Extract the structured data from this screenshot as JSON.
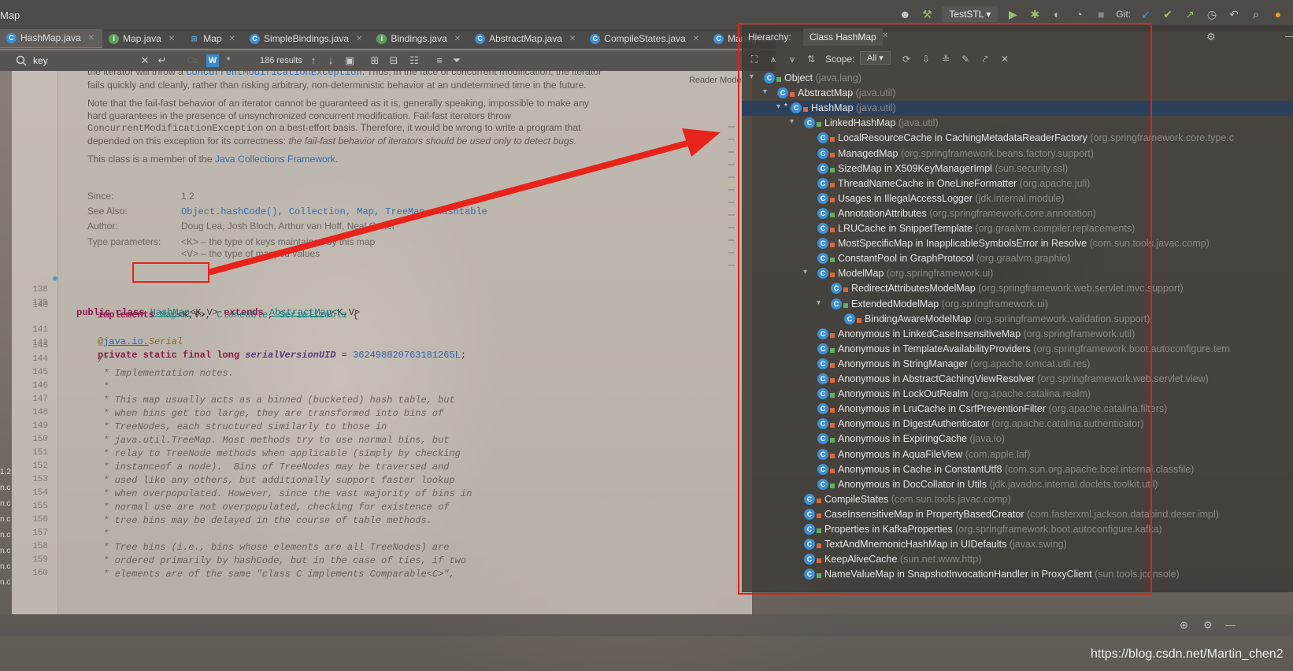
{
  "topbar": {
    "title": "Map",
    "run_config": "TestSTL",
    "git_label": "Git:"
  },
  "tabs": [
    {
      "label": "HashMap.java",
      "active": true,
      "icon": "class-icon"
    },
    {
      "label": "Map.java",
      "active": false,
      "icon": "interface-icon"
    },
    {
      "label": "Map",
      "active": false,
      "icon": "structure-icon"
    },
    {
      "label": "SimpleBindings.java",
      "active": false,
      "icon": "class-icon"
    },
    {
      "label": "Bindings.java",
      "active": false,
      "icon": "interface-icon"
    },
    {
      "label": "AbstractMap.java",
      "active": false,
      "icon": "class-icon"
    },
    {
      "label": "CompileStates.java",
      "active": false,
      "icon": "class-icon"
    },
    {
      "label": "ManagedMap.cl",
      "active": false,
      "icon": "class-icon"
    }
  ],
  "findbar": {
    "query": "key",
    "results": "186 results",
    "cc_label": "Cc",
    "w_label": "W"
  },
  "editor": {
    "reader_mode": "Reader Mode",
    "doc": {
      "p1a": "the iterator will throw a ",
      "p1b": "ConcurrentModificationException",
      "p1c": ". Thus, in the face of concurrent modification, the iterator fails quickly and cleanly, rather than risking arbitrary, non-deterministic behavior at an undetermined time in the future.",
      "p2a": "Note that the fail-fast behavior of an iterator cannot be guaranteed as it is, generally speaking, impossible to make any hard guarantees in the presence of unsynchronized concurrent modification. Fail-fast iterators throw ",
      "p2b": "ConcurrentModificationException",
      "p2c": " on a best-effort basis. Therefore, it would be wrong to write a program that depended on this exception for its correctness: ",
      "p2d": "the fail-fast behavior of iterators should be used only to detect bugs.",
      "p3a": "This class is a member of the ",
      "p3b": "Java Collections Framework",
      "p3c": ".",
      "since_label": "Since:",
      "since_value": "1.2",
      "seealso_label": "See Also:",
      "seealso_value": "Object.hashCode(), Collection, Map, TreeMap, Hashtable",
      "author_label": "Author:",
      "author_value": "Doug Lea, Josh Bloch, Arthur van Hoff, Neal Gafter",
      "typeparams_label": "Type parameters:",
      "typeparam_k": "<K> – the type of keys maintained by this map",
      "typeparam_v": "<V> – the type of mapped values"
    },
    "code": {
      "l138": "138",
      "l139": "139",
      "l140": "140",
      "l141": "141",
      "l142": "142",
      "l143": "143",
      "l144": "144",
      "l145": "145",
      "l146": "146",
      "l147": "147",
      "l148": "148",
      "l149": "149",
      "l150": "150",
      "l151": "151",
      "l152": "152",
      "l153": "153",
      "l154": "154",
      "l155": "155",
      "l156": "156",
      "l157": "157",
      "l158": "158",
      "l159": "159",
      "l160": "160",
      "kw_public_class": "public class ",
      "hashmap": "HashMap",
      "kv": "<K,V>",
      "kw_extends": " extends ",
      "abstractmap": "AbstractMap",
      "kv2": "<K,V>",
      "kw_implements": "implements ",
      "implements_rest_map": "Map",
      "implements_rest_kv": "<K,V>, ",
      "cloneable": "Cloneable",
      "comma": ", ",
      "serializable": "Serializable",
      "brace": " {",
      "ann_at": "@",
      "ann_pkg": "java.io.",
      "ann_name": "Serial",
      "kw_private": "private static final long ",
      "serial_field": "serialVersionUID",
      "serial_eq": " = ",
      "serial_val": "362498820763181265L",
      "semi": ";",
      "c144": "/*",
      "c145": " * Implementation notes.",
      "c146": " *",
      "c147": " * This map usually acts as a binned (bucketed) hash table, but",
      "c148": " * when bins get too large, they are transformed into bins of",
      "c149": " * TreeNodes, each structured similarly to those in",
      "c150": " * java.util.TreeMap. Most methods try to use normal bins, but",
      "c151": " * relay to TreeNode methods when applicable (simply by checking",
      "c152": " * instanceof a node).  Bins of TreeNodes may be traversed and",
      "c153": " * used like any others, but additionally support faster lookup",
      "c154": " * when overpopulated. However, since the vast majority of bins in",
      "c155": " * normal use are not overpopulated, checking for existence of",
      "c156": " * tree bins may be delayed in the course of table methods.",
      "c157": " *",
      "c158": " * Tree bins (i.e., bins whose elements are all TreeNodes) are",
      "c159": " * ordered primarily by hashCode, but in the case of ties, if two",
      "c160": " * elements are of the same \"class C implements Comparable<C>\","
    }
  },
  "hierarchy": {
    "label": "Hierarchy:",
    "tab": "Class HashMap",
    "scope_label": "Scope:",
    "scope_value": "All",
    "rows": [
      {
        "name": "Object",
        "pkg": "(java.lang)"
      },
      {
        "name": "AbstractMap",
        "pkg": "(java.util)"
      },
      {
        "name": "HashMap",
        "pkg": "(java.util)"
      },
      {
        "name": "LinkedHashMap",
        "pkg": "(java.util)"
      },
      {
        "name": "LocalResourceCache in CachingMetadataReaderFactory",
        "pkg": "(org.springframework.core.type.c"
      },
      {
        "name": "ManagedMap",
        "pkg": "(org.springframework.beans.factory.support)"
      },
      {
        "name": "SizedMap in X509KeyManagerImpl",
        "pkg": "(sun.security.ssl)"
      },
      {
        "name": "ThreadNameCache in OneLineFormatter",
        "pkg": "(org.apache.juli)"
      },
      {
        "name": "Usages in IllegalAccessLogger",
        "pkg": "(jdk.internal.module)"
      },
      {
        "name": "AnnotationAttributes",
        "pkg": "(org.springframework.core.annotation)"
      },
      {
        "name": "LRUCache in SnippetTemplate",
        "pkg": "(org.graalvm.compiler.replacements)"
      },
      {
        "name": "MostSpecificMap in InapplicableSymbolsError in Resolve",
        "pkg": "(com.sun.tools.javac.comp)"
      },
      {
        "name": "ConstantPool in GraphProtocol",
        "pkg": "(org.graalvm.graphio)"
      },
      {
        "name": "ModelMap",
        "pkg": "(org.springframework.ui)"
      },
      {
        "name": "RedirectAttributesModelMap",
        "pkg": "(org.springframework.web.servlet.mvc.support)"
      },
      {
        "name": "ExtendedModelMap",
        "pkg": "(org.springframework.ui)"
      },
      {
        "name": "BindingAwareModelMap",
        "pkg": "(org.springframework.validation.support)"
      },
      {
        "name": "Anonymous in LinkedCaseInsensitiveMap",
        "pkg": "(org.springframework.util)"
      },
      {
        "name": "Anonymous in TemplateAvailabilityProviders",
        "pkg": "(org.springframework.boot.autoconfigure.tem"
      },
      {
        "name": "Anonymous in StringManager",
        "pkg": "(org.apache.tomcat.util.res)"
      },
      {
        "name": "Anonymous in AbstractCachingViewResolver",
        "pkg": "(org.springframework.web.servlet.view)"
      },
      {
        "name": "Anonymous in LockOutRealm",
        "pkg": "(org.apache.catalina.realm)"
      },
      {
        "name": "Anonymous in LruCache in CsrfPreventionFilter",
        "pkg": "(org.apache.catalina.filters)"
      },
      {
        "name": "Anonymous in DigestAuthenticator",
        "pkg": "(org.apache.catalina.authenticator)"
      },
      {
        "name": "Anonymous in ExpiringCache",
        "pkg": "(java.io)"
      },
      {
        "name": "Anonymous in AquaFileView",
        "pkg": "(com.apple.laf)"
      },
      {
        "name": "Anonymous in Cache in ConstantUtf8",
        "pkg": "(com.sun.org.apache.bcel.internal.classfile)"
      },
      {
        "name": "Anonymous in DocCollator in Utils",
        "pkg": "(jdk.javadoc.internal.doclets.toolkit.util)"
      },
      {
        "name": "CompileStates",
        "pkg": "(com.sun.tools.javac.comp)"
      },
      {
        "name": "CaseInsensitiveMap in PropertyBasedCreator",
        "pkg": "(com.fasterxml.jackson.databind.deser.impl)"
      },
      {
        "name": "Properties in KafkaProperties",
        "pkg": "(org.springframework.boot.autoconfigure.kafka)"
      },
      {
        "name": "TextAndMnemonicHashMap in UIDefaults",
        "pkg": "(javax.swing)"
      },
      {
        "name": "KeepAliveCache",
        "pkg": "(sun.net.www.http)"
      },
      {
        "name": "NameValueMap in SnapshotInvocationHandler in ProxyClient",
        "pkg": "(sun.tools.jconsole)"
      }
    ]
  },
  "leftedge": [
    "1.2",
    "n.c",
    "n.c",
    "n.c",
    "n.c",
    "n.c",
    "n.c",
    "n.c"
  ],
  "watermark": "https://blog.csdn.net/Martin_chen2",
  "colors": {
    "highlight_red": "#e0241b",
    "selection": "#283e60",
    "accent_blue": "#3d8fd1"
  }
}
